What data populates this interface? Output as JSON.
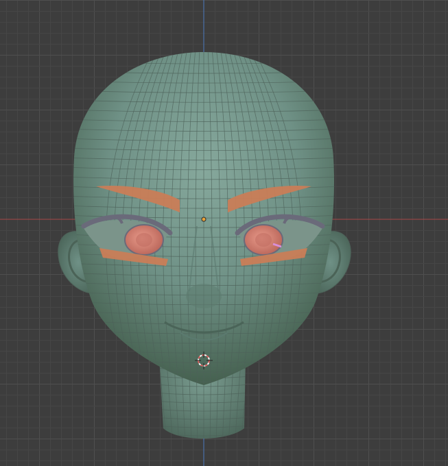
{
  "viewport": {
    "view": "front-orthographic",
    "mode": "wireframe-overlay",
    "background_color": "#3d3d3d",
    "grid_minor_color": "#464646",
    "grid_major_color": "#4f4f4f",
    "x_axis_color": "#a84848",
    "z_axis_color": "#4b79bf"
  },
  "scene": {
    "object": "head-mesh",
    "skin_color": "#6f9186",
    "brow_color": "#c97d57",
    "iris_color": "#d57f73",
    "lash_color": "#6a6a7a",
    "wire_color": "#4d6259"
  },
  "overlays": {
    "origin_marker_color": "#e8a23a",
    "cursor_ring_color": "#e06060"
  }
}
